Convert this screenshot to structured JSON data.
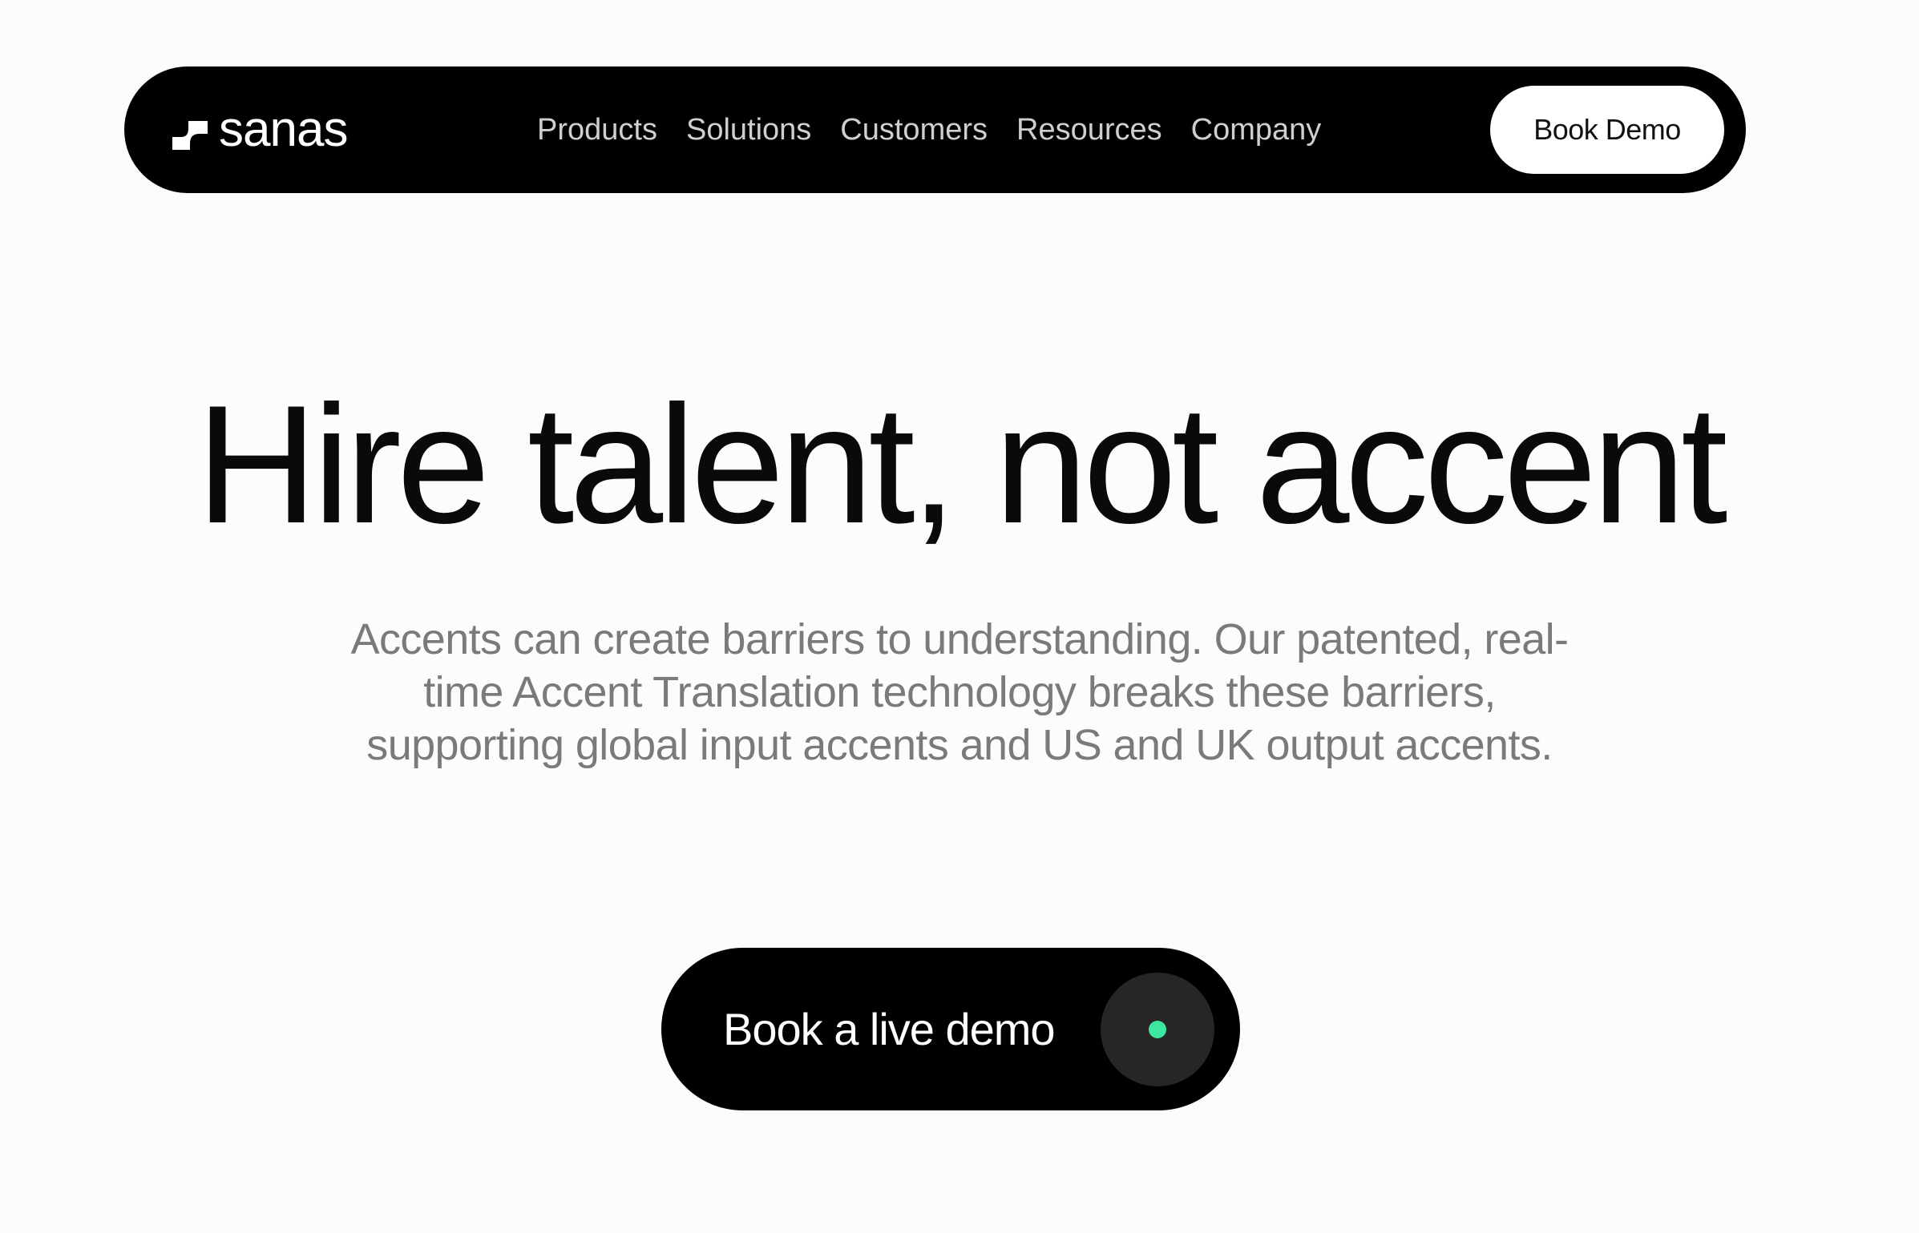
{
  "header": {
    "logo_text": "sanas",
    "nav": [
      {
        "label": "Products"
      },
      {
        "label": "Solutions"
      },
      {
        "label": "Customers"
      },
      {
        "label": "Resources"
      },
      {
        "label": "Company"
      }
    ],
    "book_demo_label": "Book Demo"
  },
  "hero": {
    "title": "Hire talent, not accent",
    "subtitle": "Accents can create barriers to understanding. Our patented, real-time Accent Translation technology breaks these barriers, supporting global input accents and US and UK output accents.",
    "cta_label": "Book a live demo"
  },
  "colors": {
    "background": "#fdfcfd",
    "nav_bg": "#000000",
    "nav_text": "#cfcfcf",
    "subtitle_text": "#7a7a7c",
    "cta_bg": "#000000",
    "cta_circle": "#262626",
    "cta_dot": "#3ee6a0"
  },
  "icons": {
    "logo_mark": "sanas-logo-mark-icon",
    "cta_indicator": "green-dot-icon"
  }
}
